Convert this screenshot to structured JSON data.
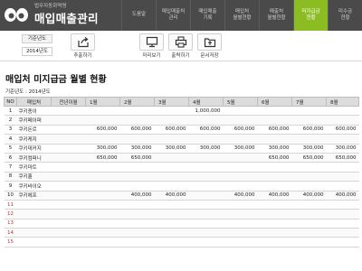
{
  "brand": {
    "subtitle": "법무자동화역명",
    "title": "매입매출관리"
  },
  "nav": {
    "tabs": [
      {
        "label": "도움말",
        "active": false
      },
      {
        "label": "매입매출처\n관리",
        "active": false
      },
      {
        "label": "매입매출\n기록",
        "active": false
      },
      {
        "label": "매입처\n월별현황",
        "active": false
      },
      {
        "label": "매출처\n월별현황",
        "active": false
      },
      {
        "label": "미지급금\n현황",
        "active": true
      },
      {
        "label": "미수금\n현황",
        "active": false
      }
    ]
  },
  "toolbar": {
    "year_label": "기준년도",
    "year_value": "2014년도",
    "extract_label": "추출하기",
    "preview_label": "미리보기",
    "print_label": "출력하기",
    "save_label": "문서저장"
  },
  "page": {
    "title": "매입처 미지급금 월별 현황",
    "caption": "기준년도 : 2014년도"
  },
  "table": {
    "headers": [
      "NO",
      "매입처",
      "전년이월",
      "1월",
      "2월",
      "3월",
      "4월",
      "5월",
      "6월",
      "7월",
      "8월"
    ],
    "rows": [
      {
        "no": "1",
        "name": "쿠키종이",
        "carry": "",
        "m": [
          "",
          "",
          "",
          "1,000,000",
          "",
          "",
          "",
          ""
        ]
      },
      {
        "no": "2",
        "name": "쿠키페이퍼",
        "carry": "",
        "m": [
          "",
          "",
          "",
          "",
          "",
          "",
          "",
          ""
        ]
      },
      {
        "no": "3",
        "name": "쿠키돈르",
        "carry": "",
        "m": [
          "600,000",
          "600,000",
          "600,000",
          "600,000",
          "600,000",
          "600,000",
          "600,000",
          "600,000"
        ]
      },
      {
        "no": "4",
        "name": "쿠키케지",
        "carry": "",
        "m": [
          "",
          "",
          "",
          "",
          "",
          "",
          "",
          ""
        ]
      },
      {
        "no": "5",
        "name": "쿠키데커지",
        "carry": "",
        "m": [
          "300,000",
          "300,000",
          "300,000",
          "300,000",
          "300,000",
          "300,000",
          "300,000",
          "300,000"
        ]
      },
      {
        "no": "6",
        "name": "쿠키컴퍼니",
        "carry": "",
        "m": [
          "650,000",
          "650,000",
          "",
          "",
          "",
          "650,000",
          "650,000",
          "650,000"
        ]
      },
      {
        "no": "7",
        "name": "쿠키마트",
        "carry": "",
        "m": [
          "",
          "",
          "",
          "",
          "",
          "",
          "",
          ""
        ]
      },
      {
        "no": "8",
        "name": "쿠키홀",
        "carry": "",
        "m": [
          "",
          "",
          "",
          "",
          "",
          "",
          "",
          ""
        ]
      },
      {
        "no": "9",
        "name": "쿠키바이오",
        "carry": "",
        "m": [
          "",
          "",
          "",
          "",
          "",
          "",
          "",
          ""
        ]
      },
      {
        "no": "10",
        "name": "쿠키에프",
        "carry": "",
        "m": [
          "",
          "400,000",
          "400,000",
          "",
          "400,000",
          "400,000",
          "400,000",
          "400,000"
        ]
      },
      {
        "no": "11",
        "name": "",
        "carry": "",
        "m": [
          "",
          "",
          "",
          "",
          "",
          "",
          "",
          ""
        ]
      },
      {
        "no": "12",
        "name": "",
        "carry": "",
        "m": [
          "",
          "",
          "",
          "",
          "",
          "",
          "",
          ""
        ]
      },
      {
        "no": "13",
        "name": "",
        "carry": "",
        "m": [
          "",
          "",
          "",
          "",
          "",
          "",
          "",
          ""
        ]
      },
      {
        "no": "14",
        "name": "",
        "carry": "",
        "m": [
          "",
          "",
          "",
          "",
          "",
          "",
          "",
          ""
        ]
      },
      {
        "no": "15",
        "name": "",
        "carry": "",
        "m": [
          "",
          "",
          "",
          "",
          "",
          "",
          "",
          ""
        ]
      }
    ]
  },
  "colors": {
    "topbar": "#4a4a4a",
    "active_tab": "#8bbd22",
    "header_row": "#dcdcdc"
  },
  "icons": {
    "logo": "eyes-logo-icon",
    "extract": "share-export-icon",
    "preview": "monitor-icon",
    "print": "printer-icon",
    "save": "folder-save-icon"
  }
}
